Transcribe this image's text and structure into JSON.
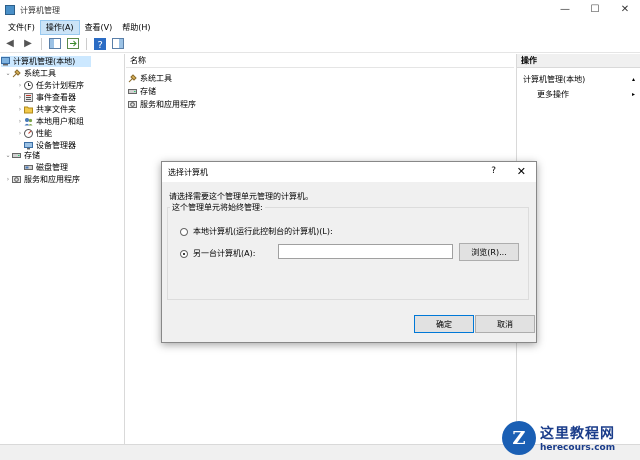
{
  "window": {
    "title": "计算机管理",
    "minimize": "—",
    "maximize": "☐",
    "close": "✕"
  },
  "menubar": [
    "文件(F)",
    "操作(A)",
    "查看(V)",
    "帮助(H)"
  ],
  "toolbar": {
    "back": "◀",
    "forward": "▶"
  },
  "tree": [
    {
      "label": "计算机管理(本地)",
      "level": 0,
      "selected": true,
      "expander": ""
    },
    {
      "label": "系统工具",
      "level": 1,
      "expander": "⌄"
    },
    {
      "label": "任务计划程序",
      "level": 2,
      "expander": "›"
    },
    {
      "label": "事件查看器",
      "level": 2,
      "expander": "›"
    },
    {
      "label": "共享文件夹",
      "level": 2,
      "expander": "›"
    },
    {
      "label": "本地用户和组",
      "level": 2,
      "expander": "›"
    },
    {
      "label": "性能",
      "level": 2,
      "expander": "›"
    },
    {
      "label": "设备管理器",
      "level": 2,
      "expander": ""
    },
    {
      "label": "存储",
      "level": 1,
      "expander": "⌄"
    },
    {
      "label": "磁盘管理",
      "level": 2,
      "expander": ""
    },
    {
      "label": "服务和应用程序",
      "level": 1,
      "expander": "›"
    }
  ],
  "list": {
    "column_header": "名称",
    "items": [
      "系统工具",
      "存储",
      "服务和应用程序"
    ]
  },
  "actions": {
    "header": "操作",
    "items": [
      "计算机管理(本地)",
      "更多操作"
    ],
    "arrows": [
      "▴",
      "▸"
    ]
  },
  "dialog": {
    "title": "选择计算机",
    "help": "?",
    "close": "✕",
    "description": "请选择需要这个管理单元管理的计算机。",
    "group_label": "这个管理单元将始终管理:",
    "radio_local": "本地计算机(运行此控制台的计算机)(L):",
    "radio_other": "另一台计算机(A):",
    "other_value": "",
    "browse": "浏览(R)...",
    "ok": "确定",
    "cancel": "取消"
  },
  "watermark": {
    "logo": "Z",
    "name": "这里教程网",
    "url": "herecours.com"
  },
  "colors": {
    "selection": "#cce8ff",
    "accent": "#0078d7"
  }
}
